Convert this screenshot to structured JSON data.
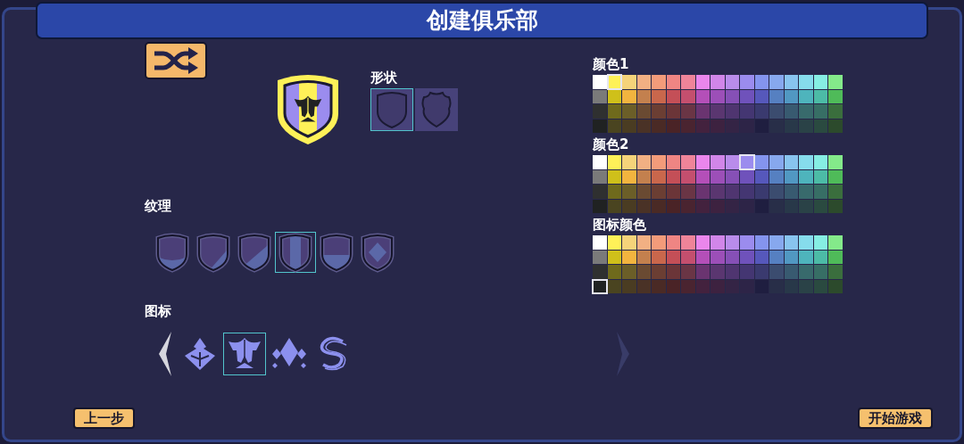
{
  "title": "创建俱乐部",
  "shape": {
    "label": "形状",
    "options": [
      {
        "kind": "classic",
        "selected": true
      },
      {
        "kind": "badge",
        "selected": false
      }
    ]
  },
  "texture": {
    "label": "纹理",
    "options": [
      {
        "kind": "bowl",
        "selected": false
      },
      {
        "kind": "slash",
        "selected": false
      },
      {
        "kind": "split",
        "selected": false
      },
      {
        "kind": "stripe",
        "selected": true
      },
      {
        "kind": "band",
        "selected": false
      },
      {
        "kind": "diamond",
        "selected": false
      }
    ]
  },
  "emblem": {
    "label": "图标",
    "arrows": [
      {
        "kind": "left",
        "disabled": false
      },
      {
        "kind": "right",
        "disabled": true
      }
    ],
    "options": [
      {
        "kind": "crystal",
        "selected": false
      },
      {
        "kind": "helmet",
        "selected": true
      },
      {
        "kind": "diamonds",
        "selected": false
      },
      {
        "kind": "swirl",
        "selected": false
      }
    ]
  },
  "palettes": [
    {
      "label": "颜色1",
      "swatches": [
        [
          {
            "color": "#ffffff",
            "selected": false
          },
          {
            "color": "#fef158",
            "selected": true
          },
          {
            "color": "#f5d37a",
            "selected": false
          },
          {
            "color": "#f2b083",
            "selected": false
          },
          {
            "color": "#f39b7a",
            "selected": false
          },
          {
            "color": "#ef8583",
            "selected": false
          },
          {
            "color": "#ef8499",
            "selected": false
          },
          {
            "color": "#ea86ec",
            "selected": false
          },
          {
            "color": "#d186e9",
            "selected": false
          },
          {
            "color": "#b98ceb",
            "selected": false
          },
          {
            "color": "#9b8cee",
            "selected": false
          },
          {
            "color": "#8494ee",
            "selected": false
          },
          {
            "color": "#87a8ee",
            "selected": false
          },
          {
            "color": "#88c4ef",
            "selected": false
          },
          {
            "color": "#86dcec",
            "selected": false
          },
          {
            "color": "#86eee3",
            "selected": false
          },
          {
            "color": "#84ea8a",
            "selected": false
          }
        ],
        [
          {
            "color": "#7a7a7a",
            "selected": false
          },
          {
            "color": "#cfc01a",
            "selected": false
          },
          {
            "color": "#f2b43f",
            "selected": false
          },
          {
            "color": "#c3804e",
            "selected": false
          },
          {
            "color": "#c9674c",
            "selected": false
          },
          {
            "color": "#c44f57",
            "selected": false
          },
          {
            "color": "#c44f6e",
            "selected": false
          },
          {
            "color": "#b44fb8",
            "selected": false
          },
          {
            "color": "#9c4fb8",
            "selected": false
          },
          {
            "color": "#8650b6",
            "selected": false
          },
          {
            "color": "#6f52bb",
            "selected": false
          },
          {
            "color": "#5658bb",
            "selected": false
          },
          {
            "color": "#5680c1",
            "selected": false
          },
          {
            "color": "#5198c2",
            "selected": false
          },
          {
            "color": "#4eb4bc",
            "selected": false
          },
          {
            "color": "#4cbba6",
            "selected": false
          },
          {
            "color": "#4fbb59",
            "selected": false
          }
        ],
        [
          {
            "color": "#2f3030",
            "selected": false
          },
          {
            "color": "#6f6a1c",
            "selected": false
          },
          {
            "color": "#6b5e28",
            "selected": false
          },
          {
            "color": "#6a4a32",
            "selected": false
          },
          {
            "color": "#6b3e33",
            "selected": false
          },
          {
            "color": "#6b3538",
            "selected": false
          },
          {
            "color": "#6a3545",
            "selected": false
          },
          {
            "color": "#6a3470",
            "selected": false
          },
          {
            "color": "#5a3670",
            "selected": false
          },
          {
            "color": "#4f3570",
            "selected": false
          },
          {
            "color": "#443672",
            "selected": false
          },
          {
            "color": "#3a3a6f",
            "selected": false
          },
          {
            "color": "#3b4c6f",
            "selected": false
          },
          {
            "color": "#385a70",
            "selected": false
          },
          {
            "color": "#386a6c",
            "selected": false
          },
          {
            "color": "#376e65",
            "selected": false
          },
          {
            "color": "#3a6e3d",
            "selected": false
          }
        ],
        [
          {
            "color": "#202222",
            "selected": false
          },
          {
            "color": "#4a4420",
            "selected": false
          },
          {
            "color": "#4a3c22",
            "selected": false
          },
          {
            "color": "#4a3226",
            "selected": false
          },
          {
            "color": "#4a2a25",
            "selected": false
          },
          {
            "color": "#4a2326",
            "selected": false
          },
          {
            "color": "#4a2430",
            "selected": false
          },
          {
            "color": "#43223e",
            "selected": false
          },
          {
            "color": "#3d2240",
            "selected": false
          },
          {
            "color": "#342445",
            "selected": false
          },
          {
            "color": "#2d2447",
            "selected": false
          },
          {
            "color": "#1f1e40",
            "selected": false
          },
          {
            "color": "#282e48",
            "selected": false
          },
          {
            "color": "#283849",
            "selected": false
          },
          {
            "color": "#2a4247",
            "selected": false
          },
          {
            "color": "#2a4a40",
            "selected": false
          },
          {
            "color": "#2c4a2c",
            "selected": false
          }
        ]
      ]
    },
    {
      "label": "颜色2",
      "swatches": [
        [
          {
            "color": "#ffffff",
            "selected": false
          },
          {
            "color": "#fef158",
            "selected": false
          },
          {
            "color": "#f5d37a",
            "selected": false
          },
          {
            "color": "#f2b083",
            "selected": false
          },
          {
            "color": "#f39b7a",
            "selected": false
          },
          {
            "color": "#ef8583",
            "selected": false
          },
          {
            "color": "#ef8499",
            "selected": false
          },
          {
            "color": "#ea86ec",
            "selected": false
          },
          {
            "color": "#d186e9",
            "selected": false
          },
          {
            "color": "#b98ceb",
            "selected": false
          },
          {
            "color": "#9b8cee",
            "selected": true
          },
          {
            "color": "#8494ee",
            "selected": false
          },
          {
            "color": "#87a8ee",
            "selected": false
          },
          {
            "color": "#88c4ef",
            "selected": false
          },
          {
            "color": "#86dcec",
            "selected": false
          },
          {
            "color": "#86eee3",
            "selected": false
          },
          {
            "color": "#84ea8a",
            "selected": false
          }
        ],
        [
          {
            "color": "#7a7a7a",
            "selected": false
          },
          {
            "color": "#cfc01a",
            "selected": false
          },
          {
            "color": "#f2b43f",
            "selected": false
          },
          {
            "color": "#c3804e",
            "selected": false
          },
          {
            "color": "#c9674c",
            "selected": false
          },
          {
            "color": "#c44f57",
            "selected": false
          },
          {
            "color": "#c44f6e",
            "selected": false
          },
          {
            "color": "#b44fb8",
            "selected": false
          },
          {
            "color": "#9c4fb8",
            "selected": false
          },
          {
            "color": "#8650b6",
            "selected": false
          },
          {
            "color": "#6f52bb",
            "selected": false
          },
          {
            "color": "#5658bb",
            "selected": false
          },
          {
            "color": "#5680c1",
            "selected": false
          },
          {
            "color": "#5198c2",
            "selected": false
          },
          {
            "color": "#4eb4bc",
            "selected": false
          },
          {
            "color": "#4cbba6",
            "selected": false
          },
          {
            "color": "#4fbb59",
            "selected": false
          }
        ],
        [
          {
            "color": "#2f3030",
            "selected": false
          },
          {
            "color": "#6f6a1c",
            "selected": false
          },
          {
            "color": "#6b5e28",
            "selected": false
          },
          {
            "color": "#6a4a32",
            "selected": false
          },
          {
            "color": "#6b3e33",
            "selected": false
          },
          {
            "color": "#6b3538",
            "selected": false
          },
          {
            "color": "#6a3545",
            "selected": false
          },
          {
            "color": "#6a3470",
            "selected": false
          },
          {
            "color": "#5a3670",
            "selected": false
          },
          {
            "color": "#4f3570",
            "selected": false
          },
          {
            "color": "#443672",
            "selected": false
          },
          {
            "color": "#3a3a6f",
            "selected": false
          },
          {
            "color": "#3b4c6f",
            "selected": false
          },
          {
            "color": "#385a70",
            "selected": false
          },
          {
            "color": "#386a6c",
            "selected": false
          },
          {
            "color": "#376e65",
            "selected": false
          },
          {
            "color": "#3a6e3d",
            "selected": false
          }
        ],
        [
          {
            "color": "#202222",
            "selected": false
          },
          {
            "color": "#4a4420",
            "selected": false
          },
          {
            "color": "#4a3c22",
            "selected": false
          },
          {
            "color": "#4a3226",
            "selected": false
          },
          {
            "color": "#4a2a25",
            "selected": false
          },
          {
            "color": "#4a2326",
            "selected": false
          },
          {
            "color": "#4a2430",
            "selected": false
          },
          {
            "color": "#43223e",
            "selected": false
          },
          {
            "color": "#3d2240",
            "selected": false
          },
          {
            "color": "#342445",
            "selected": false
          },
          {
            "color": "#2d2447",
            "selected": false
          },
          {
            "color": "#1f1e40",
            "selected": false
          },
          {
            "color": "#282e48",
            "selected": false
          },
          {
            "color": "#283849",
            "selected": false
          },
          {
            "color": "#2a4247",
            "selected": false
          },
          {
            "color": "#2a4a40",
            "selected": false
          },
          {
            "color": "#2c4a2c",
            "selected": false
          }
        ]
      ]
    },
    {
      "label": "图标颜色",
      "swatches": [
        [
          {
            "color": "#ffffff",
            "selected": false
          },
          {
            "color": "#fef158",
            "selected": false
          },
          {
            "color": "#f5d37a",
            "selected": false
          },
          {
            "color": "#f2b083",
            "selected": false
          },
          {
            "color": "#f39b7a",
            "selected": false
          },
          {
            "color": "#ef8583",
            "selected": false
          },
          {
            "color": "#ef8499",
            "selected": false
          },
          {
            "color": "#ea86ec",
            "selected": false
          },
          {
            "color": "#d186e9",
            "selected": false
          },
          {
            "color": "#b98ceb",
            "selected": false
          },
          {
            "color": "#9b8cee",
            "selected": false
          },
          {
            "color": "#8494ee",
            "selected": false
          },
          {
            "color": "#87a8ee",
            "selected": false
          },
          {
            "color": "#88c4ef",
            "selected": false
          },
          {
            "color": "#86dcec",
            "selected": false
          },
          {
            "color": "#86eee3",
            "selected": false
          },
          {
            "color": "#84ea8a",
            "selected": false
          }
        ],
        [
          {
            "color": "#7a7a7a",
            "selected": false
          },
          {
            "color": "#cfc01a",
            "selected": false
          },
          {
            "color": "#f2b43f",
            "selected": false
          },
          {
            "color": "#c3804e",
            "selected": false
          },
          {
            "color": "#c9674c",
            "selected": false
          },
          {
            "color": "#c44f57",
            "selected": false
          },
          {
            "color": "#c44f6e",
            "selected": false
          },
          {
            "color": "#b44fb8",
            "selected": false
          },
          {
            "color": "#9c4fb8",
            "selected": false
          },
          {
            "color": "#8650b6",
            "selected": false
          },
          {
            "color": "#6f52bb",
            "selected": false
          },
          {
            "color": "#5658bb",
            "selected": false
          },
          {
            "color": "#5680c1",
            "selected": false
          },
          {
            "color": "#5198c2",
            "selected": false
          },
          {
            "color": "#4eb4bc",
            "selected": false
          },
          {
            "color": "#4cbba6",
            "selected": false
          },
          {
            "color": "#4fbb59",
            "selected": false
          }
        ],
        [
          {
            "color": "#2f3030",
            "selected": false
          },
          {
            "color": "#6f6a1c",
            "selected": false
          },
          {
            "color": "#6b5e28",
            "selected": false
          },
          {
            "color": "#6a4a32",
            "selected": false
          },
          {
            "color": "#6b3e33",
            "selected": false
          },
          {
            "color": "#6b3538",
            "selected": false
          },
          {
            "color": "#6a3545",
            "selected": false
          },
          {
            "color": "#6a3470",
            "selected": false
          },
          {
            "color": "#5a3670",
            "selected": false
          },
          {
            "color": "#4f3570",
            "selected": false
          },
          {
            "color": "#443672",
            "selected": false
          },
          {
            "color": "#3a3a6f",
            "selected": false
          },
          {
            "color": "#3b4c6f",
            "selected": false
          },
          {
            "color": "#385a70",
            "selected": false
          },
          {
            "color": "#386a6c",
            "selected": false
          },
          {
            "color": "#376e65",
            "selected": false
          },
          {
            "color": "#3a6e3d",
            "selected": false
          }
        ],
        [
          {
            "color": "#202222",
            "selected": true
          },
          {
            "color": "#4a4420",
            "selected": false
          },
          {
            "color": "#4a3c22",
            "selected": false
          },
          {
            "color": "#4a3226",
            "selected": false
          },
          {
            "color": "#4a2a25",
            "selected": false
          },
          {
            "color": "#4a2326",
            "selected": false
          },
          {
            "color": "#4a2430",
            "selected": false
          },
          {
            "color": "#43223e",
            "selected": false
          },
          {
            "color": "#3d2240",
            "selected": false
          },
          {
            "color": "#342445",
            "selected": false
          },
          {
            "color": "#2d2447",
            "selected": false
          },
          {
            "color": "#1f1e40",
            "selected": false
          },
          {
            "color": "#282e48",
            "selected": false
          },
          {
            "color": "#283849",
            "selected": false
          },
          {
            "color": "#2a4247",
            "selected": false
          },
          {
            "color": "#2a4a40",
            "selected": false
          },
          {
            "color": "#2c4a2c",
            "selected": false
          }
        ]
      ]
    }
  ],
  "buttons": [
    {
      "label": "上一步"
    },
    {
      "label": "开始游戏"
    }
  ]
}
